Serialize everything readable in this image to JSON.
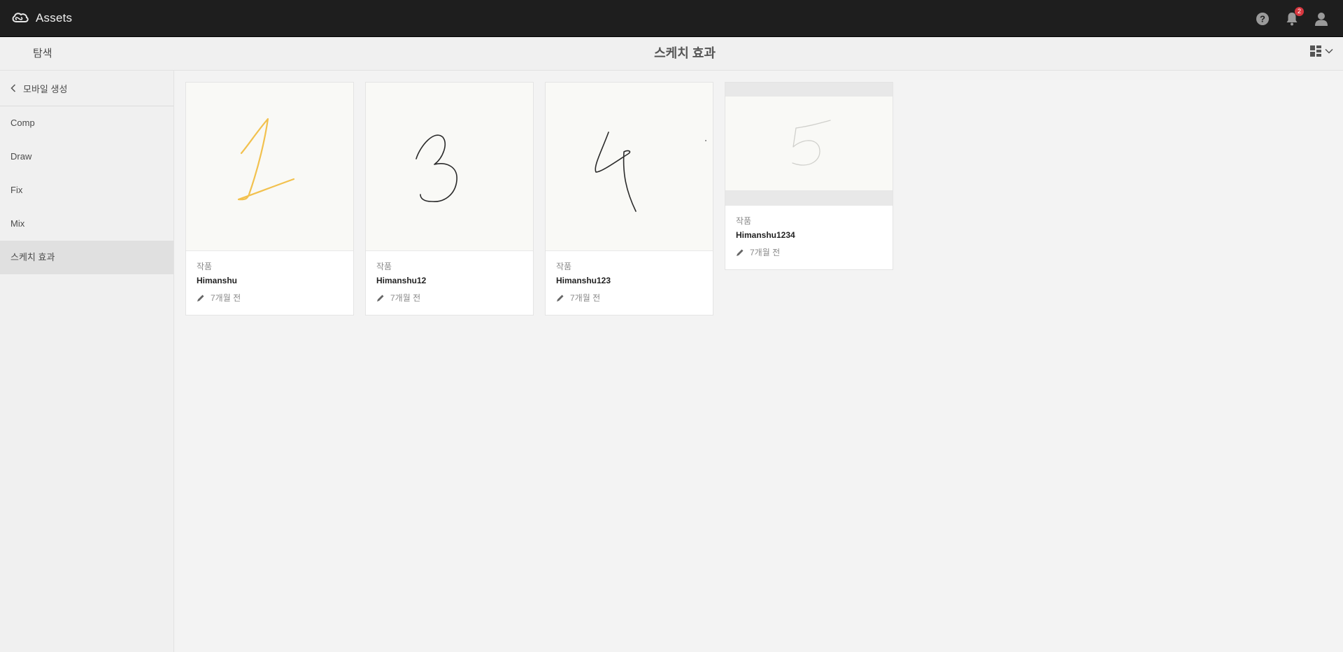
{
  "shell": {
    "app_title": "Assets",
    "notification_count": "2"
  },
  "actionbar": {
    "explore_label": "탐색",
    "page_title": "스케치 효과"
  },
  "rail": {
    "back_label": "모바일 생성",
    "items": [
      {
        "label": "Comp"
      },
      {
        "label": "Draw"
      },
      {
        "label": "Fix"
      },
      {
        "label": "Mix"
      },
      {
        "label": "스케치 효과"
      }
    ]
  },
  "cards": [
    {
      "type": "작품",
      "name": "Himanshu",
      "time": "7개월 전",
      "sketch": "1",
      "stroke_color": "#f2c14e"
    },
    {
      "type": "작품",
      "name": "Himanshu12",
      "time": "7개월 전",
      "sketch": "3",
      "stroke_color": "#2b2b2b"
    },
    {
      "type": "작품",
      "name": "Himanshu123",
      "time": "7개월 전",
      "sketch": "4",
      "stroke_color": "#2b2b2b"
    },
    {
      "type": "작품",
      "name": "Himanshu1234",
      "time": "7개월 전",
      "sketch": "5",
      "stroke_color": "#d8d8d4"
    }
  ],
  "icons": {
    "logo": "creative-cloud-icon",
    "help": "help-icon",
    "notifications": "bell-icon",
    "user": "user-icon",
    "view": "card-view-icon",
    "back": "chevron-left-icon",
    "edit": "pencil-icon"
  },
  "colors": {
    "topbar": "#1e1e1e",
    "badge": "#d7373f",
    "active_rail": "#e0e0e0"
  }
}
